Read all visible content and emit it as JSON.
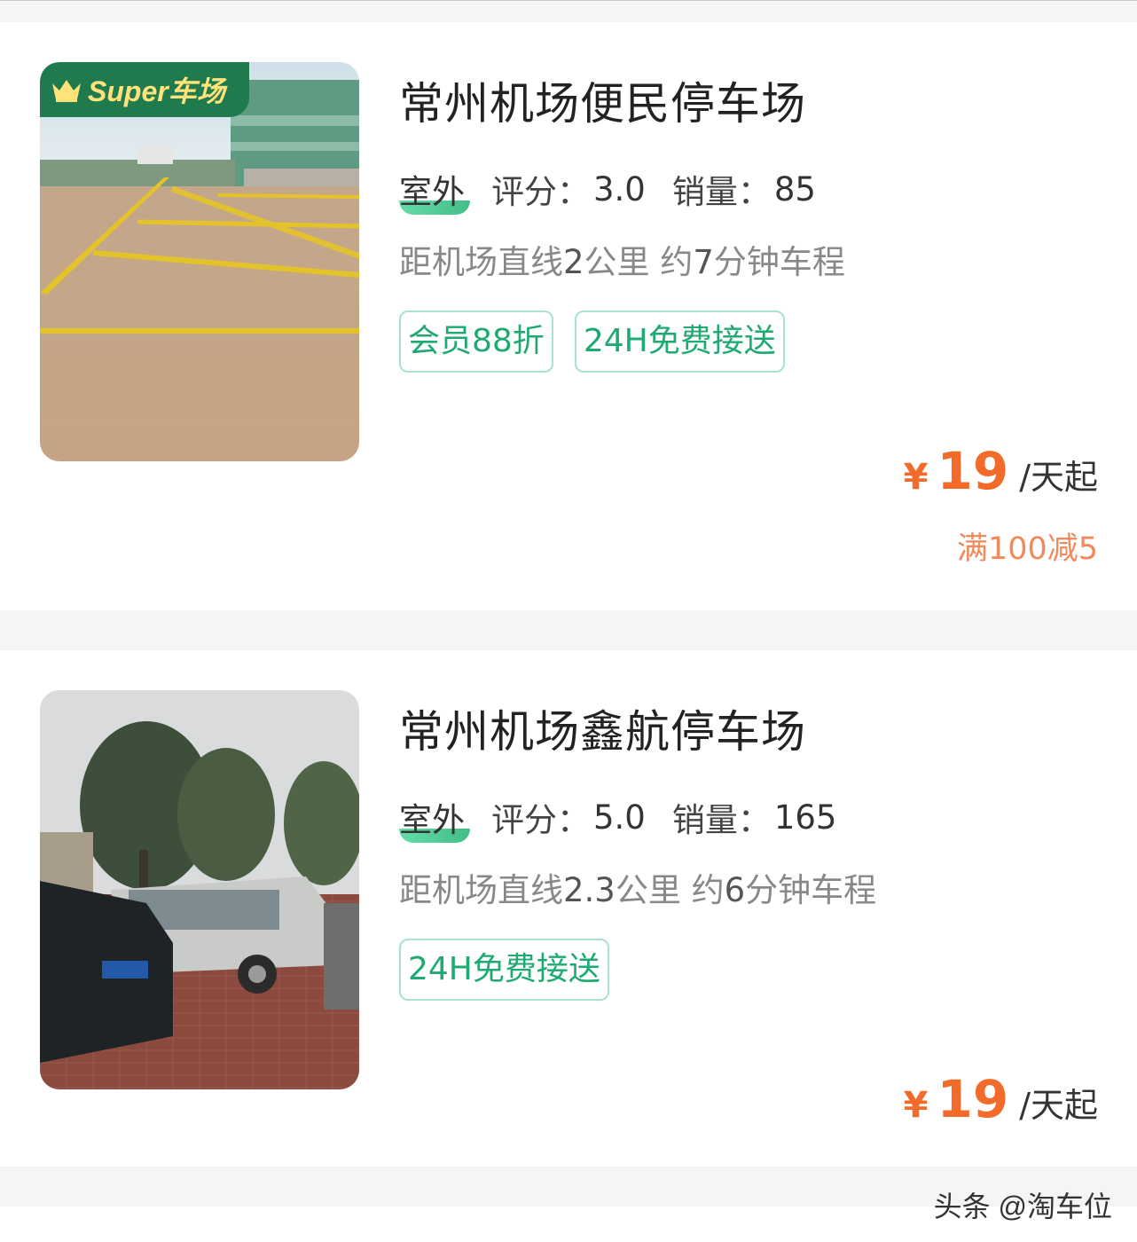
{
  "colors": {
    "accent_green": "#1faa72",
    "price_orange": "#f26b2a",
    "badge_green": "#1f7a4d",
    "badge_text": "#ffe27a"
  },
  "listings": [
    {
      "badge": "Super车场",
      "title": "常州机场便民停车场",
      "type": "室外",
      "score_label": "评分：",
      "score": "3.0",
      "sales_label": "销量：",
      "sales": "85",
      "distance_prefix": "距机场直线",
      "distance_km": "2",
      "distance_mid": "公里 约",
      "drive_min": "7",
      "distance_suffix": "分钟车程",
      "tags": [
        "会员88折",
        "24H免费接送"
      ],
      "currency": "¥",
      "price": "19",
      "price_unit": "/天起",
      "promo": "满100减5",
      "image_icon": "parking-lot-photo"
    },
    {
      "title": "常州机场鑫航停车场",
      "type": "室外",
      "score_label": "评分：",
      "score": "5.0",
      "sales_label": "销量：",
      "sales": "165",
      "distance_prefix": "距机场直线",
      "distance_km": "2.3",
      "distance_mid": "公里 约",
      "drive_min": "6",
      "distance_suffix": "分钟车程",
      "tags": [
        "24H免费接送"
      ],
      "currency": "¥",
      "price": "19",
      "price_unit": "/天起",
      "image_icon": "parking-lot-photo"
    }
  ],
  "watermark": "头条 @淘车位"
}
